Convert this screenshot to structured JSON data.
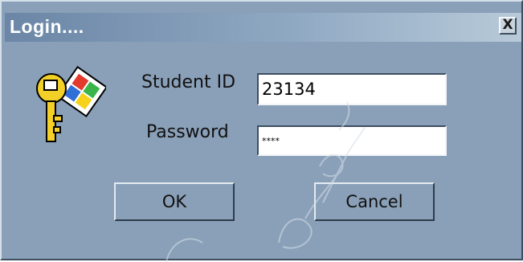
{
  "window": {
    "title": "Login....",
    "close_glyph": "X",
    "close_icon": "close-icon",
    "key_icon": "windows-key-icon"
  },
  "form": {
    "student_id_label": "Student ID",
    "student_id_value": "23134",
    "password_label": "Password",
    "password_value": "****"
  },
  "buttons": {
    "ok_label": "OK",
    "cancel_label": "Cancel"
  },
  "colors": {
    "dialog_background": "#8aa0b8",
    "title_gradient_start": "#6b86a6",
    "title_gradient_end": "#b8cad9"
  }
}
